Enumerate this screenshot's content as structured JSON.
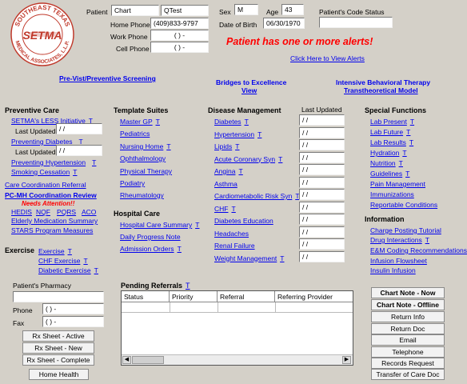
{
  "logo": {
    "top_text": "SOUTHEAST TEXAS",
    "center_text": "SETMA",
    "bottom_text": "MEDICAL ASSOCIATES, L.L.P."
  },
  "patient": {
    "label": "Patient",
    "first_name": "Chart",
    "last_name": "QTest",
    "home_phone_label": "Home Phone",
    "home_phone": "(409)833-9797",
    "work_phone_label": "Work Phone",
    "work_phone": "(   )   -",
    "cell_phone_label": "Cell Phone",
    "cell_phone": "(   )   -",
    "sex_label": "Sex",
    "sex": "M",
    "age_label": "Age",
    "age": "43",
    "dob_label": "Date of Birth",
    "dob": "06/30/1970",
    "code_status_label": "Patient's Code Status",
    "code_status": ""
  },
  "alert": {
    "message": "Patient has one or more alerts!",
    "view_link": "Click Here to View Alerts"
  },
  "top_links": {
    "previsit": "Pre-Vist/Preventive Screening",
    "bridges_line1": "Bridges to Excellence",
    "bridges_line2": "View",
    "ibt_line1": "Intensive Behavioral Therapy",
    "ibt_line2": "Transtheoretical Model"
  },
  "preventive_care": {
    "title": "Preventive Care",
    "setma_less": "SETMA's LESS Initiative",
    "last_updated_label": "Last Updated",
    "last_updated_1": " / /",
    "preventing_diabetes": "Preventing Diabetes",
    "last_updated_2": " / /",
    "preventing_hypertension": "Preventing Hypertension",
    "smoking_cessation": "Smoking Cessation",
    "care_coordination": "Care Coordination Referral",
    "pcmh_review": "PC-MH Coordination Review",
    "needs_attention": "Needs Attention!!",
    "hedis": "HEDIS",
    "nqf": "NQF",
    "pqrs": "PQRS",
    "aco": "ACO",
    "elderly_med": "Elderly Medication Summary",
    "stars": "STARS Program Measures"
  },
  "t_marker": "T",
  "exercise": {
    "title": "Exercise",
    "items": [
      "Exercise",
      "CHF Exercise",
      "Diabetic Exercise"
    ]
  },
  "template_suites": {
    "title": "Template Suites",
    "items": [
      "Master GP",
      "Pediatrics",
      "Nursing Home",
      "Ophthalmology",
      "Physical Therapy",
      "Podiatry",
      "Rheumatology"
    ]
  },
  "hospital_care": {
    "title": "Hospital Care",
    "items": [
      "Hospital Care Summary",
      "Daily Progress Note",
      "Admission Orders"
    ]
  },
  "disease_management": {
    "title": "Disease Management",
    "last_updated_header": "Last Updated",
    "items": [
      {
        "label": "Diabetes",
        "updated": " / /"
      },
      {
        "label": "Hypertension",
        "updated": " / /"
      },
      {
        "label": "Lipids",
        "updated": " / /"
      },
      {
        "label": "Acute Coronary Syn",
        "updated": " / /"
      },
      {
        "label": "Angina",
        "updated": " / /"
      },
      {
        "label": "Asthma",
        "updated": " / /"
      },
      {
        "label": "Cardiometabolic Risk Syn",
        "updated": " / /"
      },
      {
        "label": "CHF",
        "updated": " / /"
      },
      {
        "label": "Diabetes Education",
        "updated": " / /"
      },
      {
        "label": "Headaches",
        "updated": " / /"
      },
      {
        "label": "Renal Failure",
        "updated": " / /"
      },
      {
        "label": "Weight Management",
        "updated": " / /"
      }
    ]
  },
  "special_functions": {
    "title": "Special Functions",
    "items": [
      "Lab Present",
      "Lab Future",
      "Lab Results",
      "Hydration",
      "Nutrition",
      "Guidelines",
      "Pain Management",
      "Immunizations",
      "Reportable Conditions"
    ]
  },
  "information": {
    "title": "Information",
    "items": [
      "Charge Posting Tutorial",
      "Drug Interactions",
      "E&M Coding Recommendations",
      "Infusion Flowsheet",
      "Insulin Infusion"
    ]
  },
  "pharmacy": {
    "label": "Patient's Pharmacy",
    "name": "",
    "phone_label": "Phone",
    "phone": "(   )   -",
    "fax_label": "Fax",
    "fax": "(   )   -"
  },
  "rx_buttons": {
    "active": "Rx Sheet - Active",
    "new": "Rx Sheet - New",
    "complete": "Rx Sheet - Complete",
    "home_health": "Home Health"
  },
  "pending_referrals": {
    "title": "Pending Referrals",
    "columns": [
      "Status",
      "Priority",
      "Referral",
      "Referring Provider"
    ]
  },
  "right_buttons": {
    "chart_note_now": "Chart Note - Now",
    "chart_note_offline": "Chart Note - Offline",
    "return_info": "Return Info",
    "return_doc": "Return Doc",
    "email": "Email",
    "telephone": "Telephone",
    "records_request": "Records Request",
    "transfer_doc": "Transfer of Care Doc"
  },
  "colors": {
    "background": "#d4d0c8",
    "link": "#0000ee",
    "alert": "#ff0000",
    "logo": "#c0392b"
  }
}
